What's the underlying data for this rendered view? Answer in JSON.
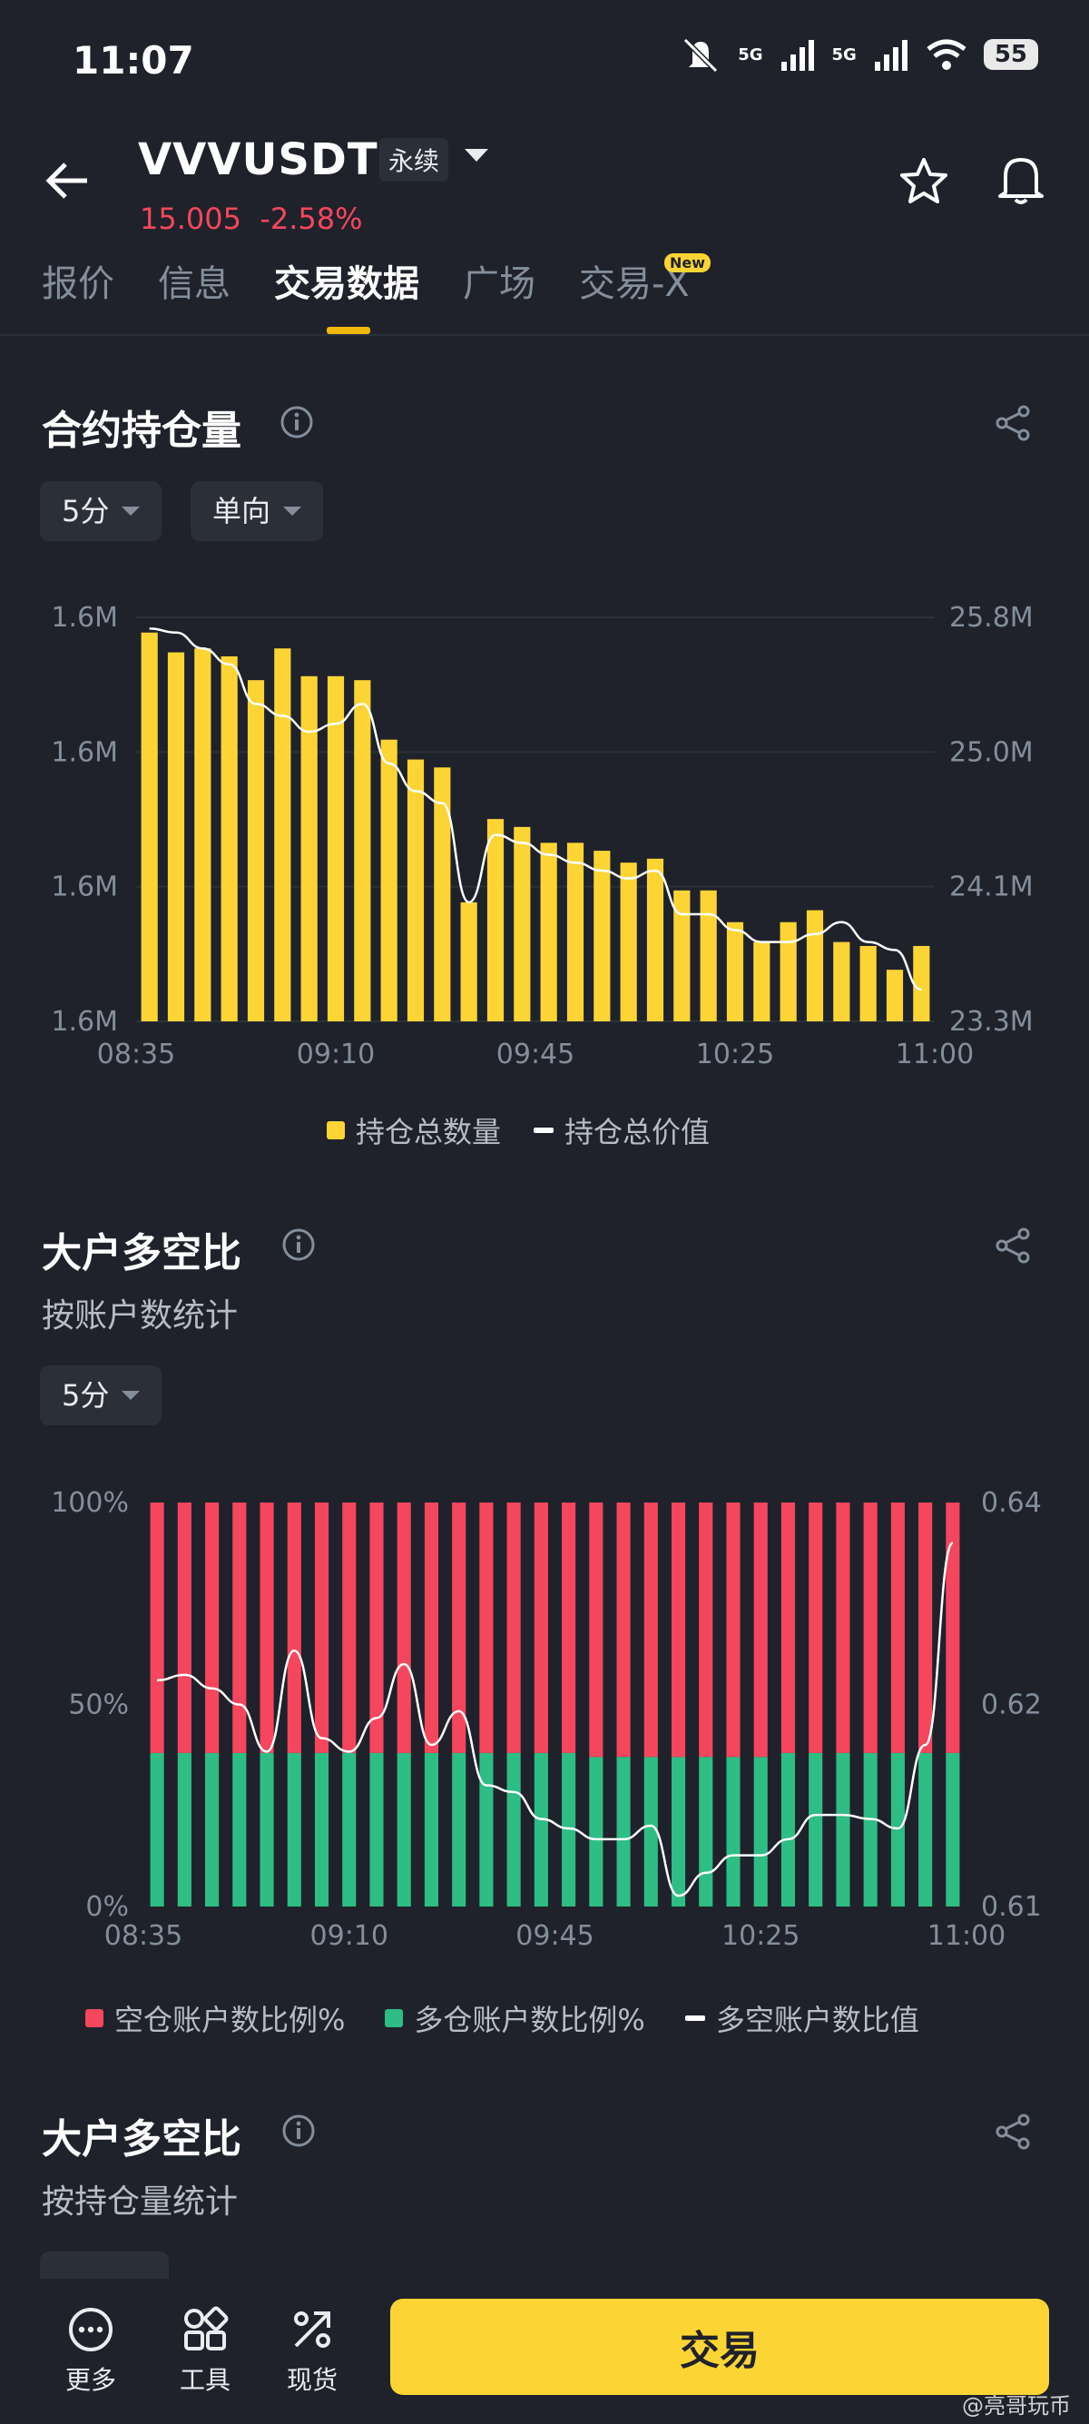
{
  "status_bar": {
    "time": "11:07",
    "net1": "5G",
    "net2": "5G",
    "battery": "55"
  },
  "header": {
    "symbol": "VVVUSDT",
    "contract_type": "永续",
    "price": "15.005",
    "change": "-2.58%"
  },
  "tabs": [
    {
      "label": "报价"
    },
    {
      "label": "信息"
    },
    {
      "label": "交易数据",
      "active": true
    },
    {
      "label": "广场"
    },
    {
      "label": "交易-X",
      "badge": "New"
    }
  ],
  "oi_section": {
    "title": "合约持仓量",
    "interval_filter": "5分",
    "side_filter": "单向",
    "legend": [
      "持仓总数量",
      "持仓总价值"
    ]
  },
  "ls_account_section": {
    "title": "大户多空比",
    "subtitle": "按账户数统计",
    "interval_filter": "5分",
    "legend": [
      "空仓账户数比例%",
      "多仓账户数比例%",
      "多空账户数比值"
    ]
  },
  "ls_position_section": {
    "title": "大户多空比",
    "subtitle": "按持仓量统计"
  },
  "bottom_nav": [
    {
      "label": "更多",
      "icon": "more-icon"
    },
    {
      "label": "工具",
      "icon": "tools-icon"
    },
    {
      "label": "现货",
      "icon": "spot-icon"
    }
  ],
  "trade_button": "交易",
  "watermark": "@亮哥玩币",
  "colors": {
    "accent": "#fcd535",
    "down": "#f6465d",
    "up": "#2ebd85",
    "bg": "#1f222b"
  },
  "chart_data": [
    {
      "type": "bar",
      "x_ticks": [
        "08:35",
        "09:10",
        "09:45",
        "10:25",
        "11:00"
      ],
      "y_left_ticks": [
        "1.6M",
        "1.6M",
        "1.6M",
        "1.6M"
      ],
      "y_right_ticks": [
        "25.8M",
        "25.0M",
        "24.1M",
        "23.3M"
      ],
      "series": [
        {
          "name": "持仓总数量",
          "type": "bar",
          "color": "#fcd535",
          "values": [
            0.98,
            0.93,
            0.94,
            0.92,
            0.86,
            0.94,
            0.87,
            0.87,
            0.86,
            0.71,
            0.66,
            0.64,
            0.3,
            0.51,
            0.49,
            0.45,
            0.45,
            0.43,
            0.4,
            0.41,
            0.33,
            0.33,
            0.25,
            0.2,
            0.25,
            0.28,
            0.2,
            0.19,
            0.13,
            0.19
          ]
        },
        {
          "name": "持仓总价值",
          "type": "line",
          "color": "#ffffff",
          "values": [
            0.99,
            0.98,
            0.94,
            0.9,
            0.8,
            0.77,
            0.73,
            0.75,
            0.8,
            0.65,
            0.58,
            0.55,
            0.3,
            0.47,
            0.45,
            0.42,
            0.4,
            0.38,
            0.36,
            0.38,
            0.27,
            0.27,
            0.23,
            0.2,
            0.2,
            0.22,
            0.25,
            0.2,
            0.18,
            0.08
          ]
        }
      ]
    },
    {
      "type": "bar",
      "x_ticks": [
        "08:35",
        "09:10",
        "09:45",
        "10:25",
        "11:00"
      ],
      "y_left_ticks": [
        "100%",
        "50%",
        "0%"
      ],
      "y_right_ticks": [
        "0.64",
        "0.62",
        "0.61"
      ],
      "series": [
        {
          "name": "空仓账户数比例%",
          "type": "bar",
          "color": "#f6465d",
          "values": [
            62,
            62,
            62,
            62,
            62,
            62,
            62,
            62,
            62,
            62,
            62,
            62,
            62,
            62,
            62,
            62,
            63,
            63,
            63,
            63,
            63,
            63,
            63,
            62,
            62,
            62,
            62,
            62,
            62,
            62
          ]
        },
        {
          "name": "多仓账户数比例%",
          "type": "bar",
          "color": "#2ebd85",
          "values": [
            38,
            38,
            38,
            38,
            38,
            38,
            38,
            38,
            38,
            38,
            38,
            38,
            38,
            38,
            38,
            38,
            37,
            37,
            37,
            37,
            37,
            37,
            37,
            38,
            38,
            38,
            38,
            38,
            38,
            38
          ]
        },
        {
          "name": "多空账户数比值",
          "type": "line",
          "color": "#ffffff",
          "values": [
            0.6268,
            0.6272,
            0.6262,
            0.625,
            0.6215,
            0.629,
            0.6225,
            0.6215,
            0.624,
            0.628,
            0.622,
            0.6245,
            0.619,
            0.6185,
            0.6165,
            0.6158,
            0.615,
            0.615,
            0.616,
            0.6108,
            0.6125,
            0.6138,
            0.6138,
            0.615,
            0.6168,
            0.6168,
            0.6165,
            0.6158,
            0.622,
            0.637
          ]
        }
      ]
    }
  ]
}
